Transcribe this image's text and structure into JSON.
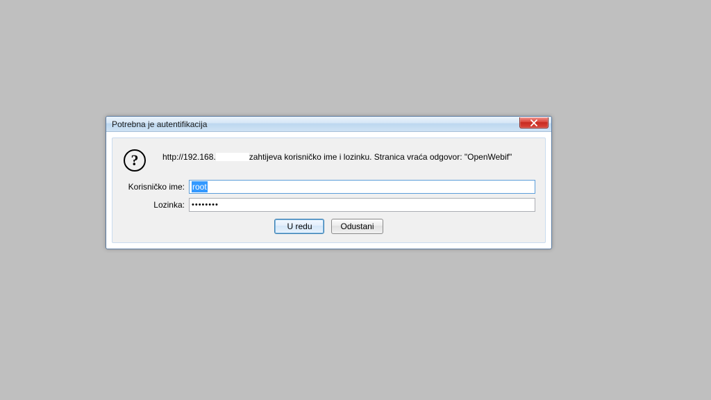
{
  "dialog": {
    "title": "Potrebna je autentifikacija",
    "message_prefix": "http://192.168.",
    "message_suffix": "zahtijeva korisničko ime i lozinku. Stranica vraća odgovor: \"OpenWebif\"",
    "username_label": "Korisničko ime:",
    "username_value": "root",
    "password_label": "Lozinka:",
    "password_mask": "••••••••",
    "ok_label": "U redu",
    "cancel_label": "Odustani"
  }
}
